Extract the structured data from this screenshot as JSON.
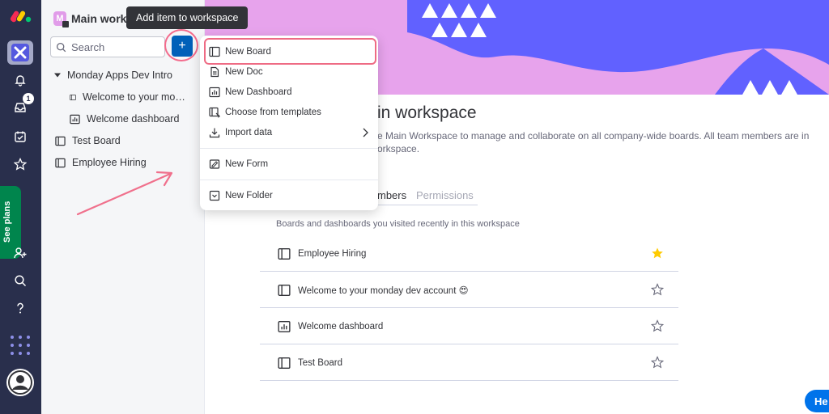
{
  "tooltip": {
    "text": "Add item to workspace"
  },
  "workspace": {
    "initial": "M",
    "name": "Main workspace"
  },
  "search": {
    "placeholder": "Search"
  },
  "rail": {
    "inbox_count": "1",
    "see_plans": "See plans"
  },
  "tree": {
    "folder": "Monday Apps Dev Intro",
    "items": [
      {
        "label": "Welcome to your monday dev account",
        "icon": "board-icon"
      },
      {
        "label": "Welcome dashboard",
        "icon": "dashboard-icon"
      }
    ],
    "root_items": [
      {
        "label": "Test Board",
        "icon": "board-icon"
      },
      {
        "label": "Employee Hiring",
        "icon": "board-icon"
      }
    ]
  },
  "menu": {
    "items": [
      {
        "label": "New Board",
        "icon": "board-icon"
      },
      {
        "label": "New Doc",
        "icon": "doc-icon"
      },
      {
        "label": "New Dashboard",
        "icon": "dashboard-icon"
      },
      {
        "label": "Choose from templates",
        "icon": "templates-icon"
      },
      {
        "label": "Import data",
        "icon": "import-icon"
      },
      {
        "label": "New Form",
        "icon": "form-icon"
      },
      {
        "label": "New Folder",
        "icon": "folder-icon"
      }
    ]
  },
  "main": {
    "title": "in workspace",
    "desc_line1": "e Main Workspace to manage and collaborate on all company-wide boards. All team members are in",
    "desc_line2": "orkspace.",
    "tab_members": "mbers",
    "tab_permissions": "Permissions",
    "recent_label": "Boards and dashboards you visited recently in this workspace",
    "recent": [
      {
        "label": "Employee Hiring",
        "icon": "board-icon",
        "starred": true
      },
      {
        "label": "Welcome to your monday dev account 😍",
        "icon": "board-icon",
        "starred": false
      },
      {
        "label": "Welcome dashboard",
        "icon": "dashboard-icon",
        "starred": false
      },
      {
        "label": "Test Board",
        "icon": "board-icon",
        "starred": false
      }
    ]
  },
  "help": {
    "label": "He"
  },
  "colors": {
    "accent": "#0060b9",
    "rail": "#292f4c",
    "banner": "#e7a3ec",
    "banner_blob": "#6161ff",
    "highlight": "#ee6b84",
    "star": "#ffcb00"
  }
}
